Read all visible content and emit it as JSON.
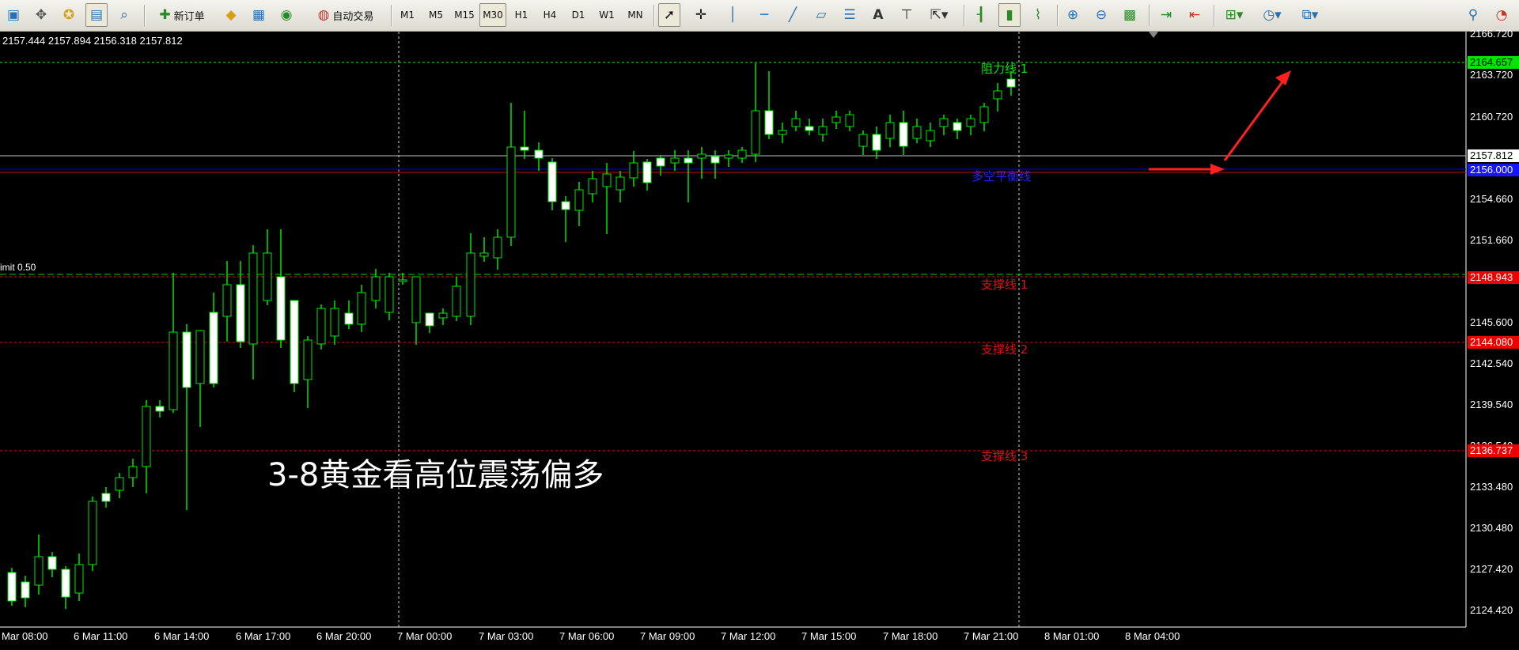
{
  "toolbar": {
    "buttons": [
      {
        "name": "new-chart-icon",
        "glyph": "▣"
      },
      {
        "name": "move-icon",
        "glyph": "✥"
      },
      {
        "name": "favorites-icon",
        "glyph": "✪"
      },
      {
        "name": "data-window-icon",
        "glyph": "▤"
      },
      {
        "name": "zoom-window-icon",
        "glyph": "⌕"
      }
    ],
    "new_order_label": "新订单",
    "auto_trade_label": "自动交易",
    "timeframes": [
      "M1",
      "M5",
      "M15",
      "M30",
      "H1",
      "H4",
      "D1",
      "W1",
      "MN"
    ],
    "active_timeframe": "M30"
  },
  "chart": {
    "ohlc_readout": "2157.444 2157.894 2156.318 2157.812",
    "limit_label": "imit 0.50",
    "overlay_title": "3-8黄金看高位震荡偏多",
    "price_axis": [
      "2166.720",
      "2163.720",
      "2160.720",
      "2157.812",
      "2154.660",
      "2151.660",
      "2145.600",
      "2142.540",
      "2139.540",
      "2136.540",
      "2133.480",
      "2130.480",
      "2127.420",
      "2124.420"
    ],
    "price_tags": {
      "resistance_1": "2164.657",
      "current": "2157.812",
      "pivot": "2156.000",
      "support_1": "2148.943",
      "support_2": "2144.080",
      "support_3": "2136.737"
    },
    "line_labels": {
      "resistance_1": "阻力线 1",
      "pivot": "多空平衡线",
      "support_1": "支撑线 1",
      "support_2": "支撑线 2",
      "support_3": "支撑线 3"
    },
    "time_axis": [
      "Mar 08:00",
      "6 Mar 11:00",
      "6 Mar 14:00",
      "6 Mar 17:00",
      "6 Mar 20:00",
      "7 Mar 00:00",
      "7 Mar 03:00",
      "7 Mar 06:00",
      "7 Mar 09:00",
      "7 Mar 12:00",
      "7 Mar 15:00",
      "7 Mar 18:00",
      "7 Mar 21:00",
      "8 Mar 01:00",
      "8 Mar 04:00"
    ],
    "colors": {
      "bull_body": "#000000",
      "bear_body": "#ffffff",
      "wick": "#00e600",
      "resistance": "#00ff00",
      "support": "#ff0000",
      "pivot": "#0000ff",
      "arrow": "#ff2020"
    }
  }
}
